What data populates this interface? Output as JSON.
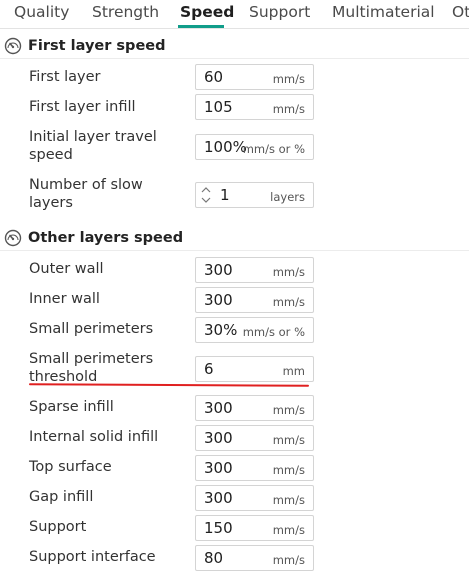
{
  "tabs": [
    "Quality",
    "Strength",
    "Speed",
    "Support",
    "Multimaterial",
    "Ot"
  ],
  "active_tab": "Speed",
  "accent_color": "#119d8a",
  "sections": [
    {
      "title": "First layer speed",
      "icon": "speedometer-icon",
      "rows": [
        {
          "label": "First layer",
          "value": "60",
          "unit": "mm/s"
        },
        {
          "label": "First layer infill",
          "value": "105",
          "unit": "mm/s"
        },
        {
          "label": "Initial layer travel speed",
          "value": "100%",
          "unit": "mm/s or %"
        },
        {
          "label": "Number of slow layers",
          "value": "1",
          "unit": "layers"
        }
      ]
    },
    {
      "title": "Other layers speed",
      "icon": "speedometer-icon",
      "rows": [
        {
          "label": "Outer wall",
          "value": "300",
          "unit": "mm/s"
        },
        {
          "label": "Inner wall",
          "value": "300",
          "unit": "mm/s"
        },
        {
          "label": "Small perimeters",
          "value": "30%",
          "unit": "mm/s or %"
        },
        {
          "label": "Small perimeters threshold",
          "value": "6",
          "unit": "mm"
        },
        {
          "label": "Sparse infill",
          "value": "300",
          "unit": "mm/s"
        },
        {
          "label": "Internal solid infill",
          "value": "300",
          "unit": "mm/s"
        },
        {
          "label": "Top surface",
          "value": "300",
          "unit": "mm/s"
        },
        {
          "label": "Gap infill",
          "value": "300",
          "unit": "mm/s"
        },
        {
          "label": "Support",
          "value": "150",
          "unit": "mm/s"
        },
        {
          "label": "Support interface",
          "value": "80",
          "unit": "mm/s"
        }
      ]
    }
  ],
  "label_lines": {
    "initial_travel_1": "Initial layer travel",
    "initial_travel_2": "speed",
    "slow_layers_1": "Number of slow",
    "slow_layers_2": "layers",
    "small_thresh_1": "Small perimeters",
    "small_thresh_2": "threshold"
  }
}
